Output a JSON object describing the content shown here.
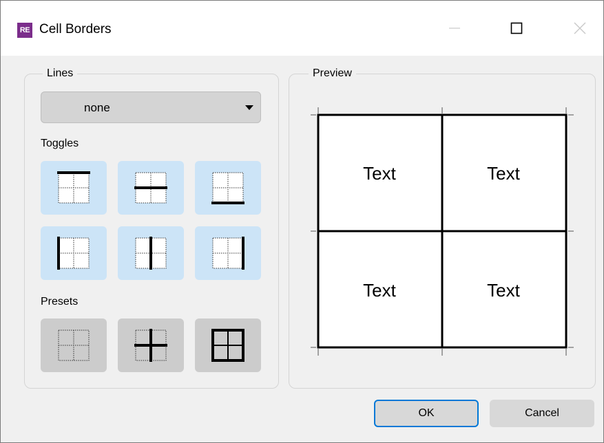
{
  "window": {
    "app_icon_text": "RE",
    "title": "Cell Borders",
    "controls": [
      "minimize-icon",
      "maximize-icon",
      "close-icon"
    ]
  },
  "lines": {
    "group_label": "Lines",
    "style_value": "none",
    "toggles_label": "Toggles",
    "toggles": [
      {
        "name": "border-top",
        "icon": "border-top-icon"
      },
      {
        "name": "border-inner-horizontal",
        "icon": "border-inner-horizontal-icon"
      },
      {
        "name": "border-bottom",
        "icon": "border-bottom-icon"
      },
      {
        "name": "border-left",
        "icon": "border-left-icon"
      },
      {
        "name": "border-inner-vertical",
        "icon": "border-inner-vertical-icon"
      },
      {
        "name": "border-right",
        "icon": "border-right-icon"
      }
    ],
    "presets_label": "Presets",
    "presets": [
      {
        "name": "no-borders",
        "icon": "no-borders-icon"
      },
      {
        "name": "inner-borders",
        "icon": "inner-borders-icon"
      },
      {
        "name": "all-borders",
        "icon": "all-borders-icon"
      }
    ]
  },
  "preview": {
    "group_label": "Preview",
    "cells": [
      "Text",
      "Text",
      "Text",
      "Text"
    ]
  },
  "buttons": {
    "ok": "OK",
    "cancel": "Cancel"
  },
  "colors": {
    "toggle_bg": "#cce4f7",
    "preset_bg": "#cccccc",
    "ok_focus_border": "#0078d7",
    "app_icon": "#7b2d8b"
  }
}
